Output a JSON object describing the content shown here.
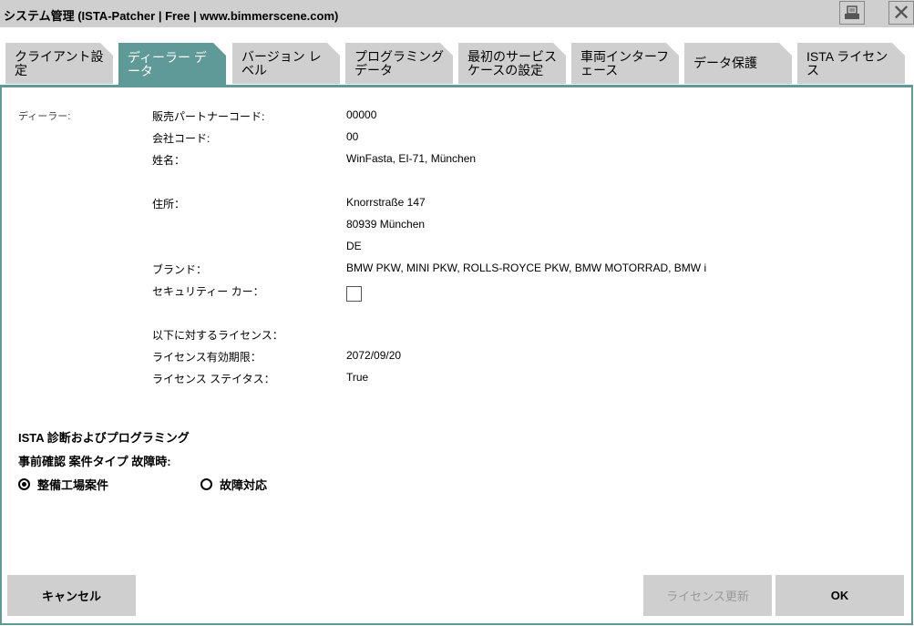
{
  "window": {
    "title": "システム管理 (ISTA-Patcher | Free | www.bimmerscene.com)",
    "print_icon": "printer-icon",
    "close_icon": "close-icon"
  },
  "tabs": [
    {
      "label": "クライアント設定",
      "active": false
    },
    {
      "label": "ディーラー データ",
      "active": true
    },
    {
      "label": "バージョン レベル",
      "active": false
    },
    {
      "label": "プログラミングデータ",
      "active": false
    },
    {
      "label": "最初のサービスケースの設定",
      "active": false
    },
    {
      "label": "車両インターフェース",
      "active": false
    },
    {
      "label": "データ保護",
      "active": false
    },
    {
      "label": "ISTA ライセンス",
      "active": false
    }
  ],
  "dealer": {
    "section_label": "ディーラー:",
    "rows": [
      {
        "label": "販売パートナーコード:",
        "value": "00000"
      },
      {
        "label": "会社コード:",
        "value": "00"
      },
      {
        "label": "姓名：",
        "value": "WinFasta, EI-71, München"
      },
      {
        "label": "住所：",
        "value": "Knorrstraße 147"
      },
      {
        "label": "",
        "value": "80939 München"
      },
      {
        "label": "",
        "value": "DE"
      },
      {
        "label": "ブランド：",
        "value": "BMW PKW, MINI PKW, ROLLS-ROYCE PKW, BMW MOTORRAD, BMW i"
      },
      {
        "label": "セキュリティー カー：",
        "value": ""
      },
      {
        "label": "以下に対するライセンス：",
        "value": ""
      },
      {
        "label": "ライセンス有効期限：",
        "value": "2072/09/20"
      },
      {
        "label": "ライセンス ステイタス：",
        "value": "True"
      }
    ],
    "security_car_checked": false
  },
  "ista": {
    "heading": "ISTA 診断およびプログラミング",
    "subheading": "事前確認 案件タイプ 故障時:",
    "options": [
      {
        "label": "整備工場案件",
        "selected": true
      },
      {
        "label": "故障対応",
        "selected": false
      }
    ]
  },
  "buttons": {
    "cancel": "キャンセル",
    "license_update": "ライセンス更新",
    "ok": "OK"
  }
}
